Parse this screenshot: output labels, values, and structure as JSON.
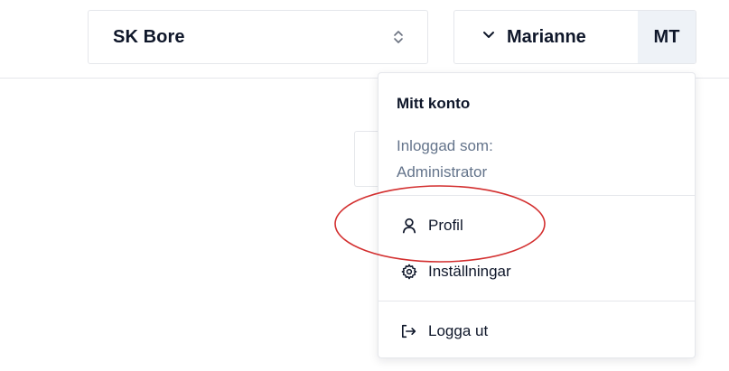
{
  "header": {
    "club_select": {
      "value": "SK Bore",
      "icon": "chevron-up-down-icon"
    },
    "user_button": {
      "name": "Marianne",
      "initials": "MT",
      "icon": "chevron-down-icon"
    }
  },
  "account_menu": {
    "heading": "Mitt konto",
    "logged_in_label": "Inloggad som:",
    "role": "Administrator",
    "items": [
      {
        "label": "Profil",
        "icon": "user-icon"
      },
      {
        "label": "Inställningar",
        "icon": "gear-icon"
      },
      {
        "label": "Logga ut",
        "icon": "logout-icon"
      }
    ]
  },
  "annotation": {
    "color": "#d32f2f",
    "shape": "ellipse",
    "target": "Profil"
  }
}
